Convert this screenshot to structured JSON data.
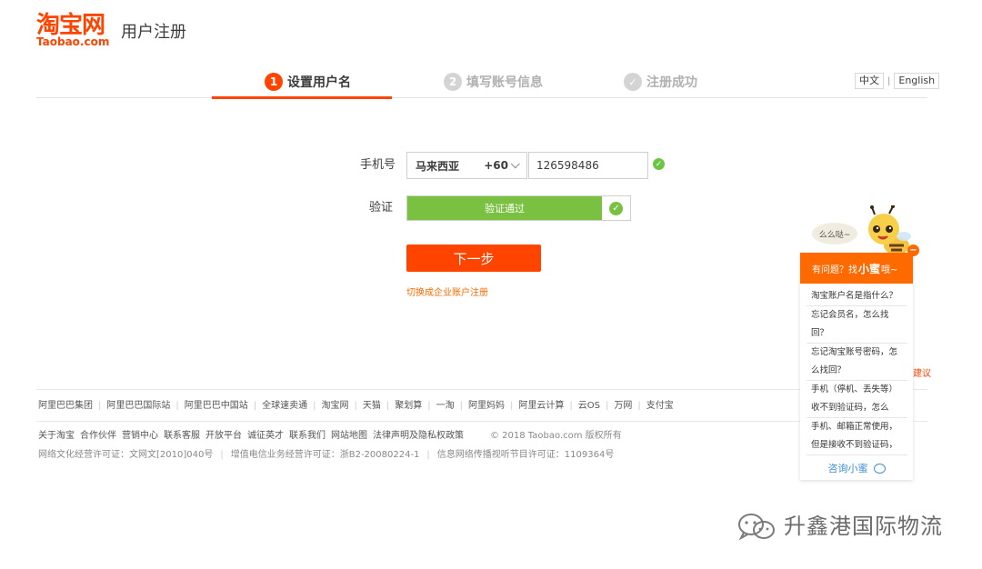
{
  "header": {
    "logo_cn": "淘宝网",
    "logo_en": "Taobao.com",
    "title": "用户注册"
  },
  "steps": [
    {
      "num": "1",
      "label": "设置用户名",
      "state": "active"
    },
    {
      "num": "2",
      "label": "填写账号信息",
      "state": "pending"
    },
    {
      "num": "✓",
      "label": "注册成功",
      "state": "pending"
    }
  ],
  "lang": {
    "zh": "中文",
    "sep": "|",
    "en": "English"
  },
  "form": {
    "phone_label": "手机号",
    "country_name": "马来西亚",
    "country_code": "+60",
    "phone_value": "126598486",
    "verify_label": "验证",
    "verify_text": "验证通过",
    "next_label": "下一步",
    "switch_link": "切换成企业账户注册"
  },
  "footer": {
    "links_row1": [
      "阿里巴巴集团",
      "阿里巴巴国际站",
      "阿里巴巴中国站",
      "全球速卖通",
      "淘宝网",
      "天猫",
      "聚划算",
      "一淘",
      "阿里妈妈",
      "阿里云计算",
      "云OS",
      "万网",
      "支付宝"
    ],
    "links_row2": [
      "关于淘宝",
      "合作伙伴",
      "营销中心",
      "联系客服",
      "开放平台",
      "诚征英才",
      "联系我们",
      "网站地图",
      "法律声明及隐私权政策"
    ],
    "copyright": "© 2018 Taobao.com 版权所有",
    "license": [
      "网络文化经营许可证：文网文[2010]040号",
      "增值电信业务经营许可证：浙B2-20080224-1",
      "信息网络传播视听节目许可证：1109364号"
    ]
  },
  "help": {
    "bubble": "么么哒~",
    "header_pre": "有问题？找",
    "header_name": "小蜜",
    "header_post": "哦~",
    "questions": [
      "淘宝账户名是指什么？",
      "忘记会员名，怎么找回？",
      "忘记淘宝账号密码，怎么找回？",
      "手机（停机、丢失等）收不到验证码，怎么",
      "手机、邮箱正常使用，但是接收不到验证码，"
    ],
    "consult": "咨询小蜜",
    "side_fragment": "建议"
  },
  "watermark": {
    "text": "升鑫港国际物流"
  },
  "colors": {
    "brand": "#ff4400",
    "success": "#7ac142",
    "link": "#3d8fd9"
  },
  "icons": [
    "check-circle-icon",
    "chevron-down-icon",
    "chat-icon",
    "close-icon",
    "mascot-icon",
    "wechat-icon"
  ]
}
